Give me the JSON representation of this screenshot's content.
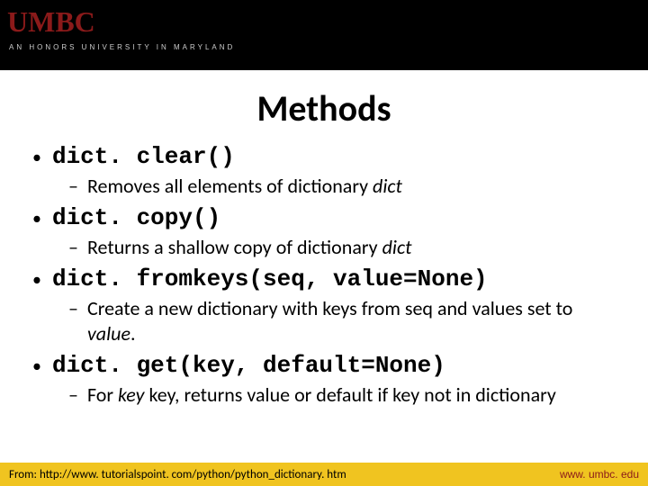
{
  "header": {
    "logo_text": "UMBC",
    "tagline": "AN HONORS UNIVERSITY IN MARYLAND"
  },
  "title": "Methods",
  "methods": [
    {
      "name": "dict. clear()",
      "desc_pre": "Removes all elements of dictionary ",
      "desc_em": "dict",
      "desc_post": ""
    },
    {
      "name": "dict. copy()",
      "desc_pre": "Returns a shallow copy of dictionary ",
      "desc_em": "dict",
      "desc_post": ""
    },
    {
      "name": "dict. fromkeys(seq, value=None)",
      "desc_pre": "Create a new dictionary with keys from seq and values set to ",
      "desc_em": "value",
      "desc_post": "."
    },
    {
      "name": "dict. get(key, default=None)",
      "desc_pre": "For ",
      "desc_em": "key",
      "desc_post": " key, returns value or default if key not in dictionary"
    }
  ],
  "footer": {
    "source": "From: http://www. tutorialspoint. com/python/python_dictionary. htm",
    "site": "www. umbc. edu"
  }
}
